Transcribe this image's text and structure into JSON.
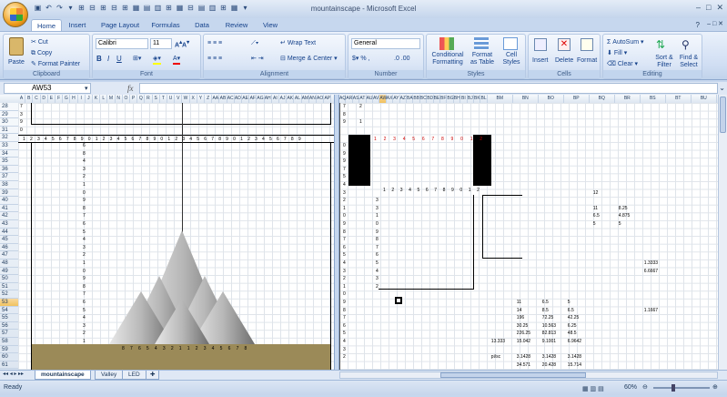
{
  "window": {
    "title": "mountainscape - Microsoft Excel"
  },
  "tabs": [
    "Home",
    "Insert",
    "Page Layout",
    "Formulas",
    "Data",
    "Review",
    "View"
  ],
  "clipboard": {
    "paste": "Paste",
    "cut": "Cut",
    "copy": "Copy",
    "format_painter": "Format Painter",
    "label": "Clipboard"
  },
  "font": {
    "name": "Calibri",
    "size": "11",
    "label": "Font"
  },
  "alignment": {
    "wrap": "Wrap Text",
    "merge": "Merge & Center",
    "label": "Alignment"
  },
  "number": {
    "format": "General",
    "label": "Number"
  },
  "styles": {
    "conditional": "Conditional Formatting",
    "as_table": "Format as Table",
    "cell_styles": "Cell Styles",
    "label": "Styles"
  },
  "cells": {
    "insert": "Insert",
    "delete": "Delete",
    "format": "Format",
    "label": "Cells"
  },
  "editing": {
    "autosum": "AutoSum",
    "fill": "Fill",
    "clear": "Clear",
    "sort": "Sort & Filter",
    "find": "Find & Select",
    "label": "Editing"
  },
  "formula_bar": {
    "name_box": "AW53",
    "fx": "fx",
    "value": ""
  },
  "left_columns": [
    "A",
    "B",
    "C",
    "D",
    "E",
    "F",
    "G",
    "H",
    "I",
    "J",
    "K",
    "L",
    "M",
    "N",
    "O",
    "P",
    "Q",
    "R",
    "S",
    "T",
    "U",
    "V",
    "W",
    "X",
    "Y",
    "Z",
    "AA",
    "AB",
    "AC",
    "AD",
    "AE",
    "AF",
    "AG",
    "AH",
    "AI",
    "AJ",
    "AK",
    "AL",
    "AM",
    "AN",
    "AO",
    "AP"
  ],
  "right_columns": [
    "AQ",
    "AR",
    "AS",
    "AT",
    "AU",
    "AV",
    "AW",
    "AX",
    "AY",
    "AZ",
    "BA",
    "BB",
    "BC",
    "BD",
    "BE",
    "BF",
    "BG",
    "BH",
    "BI",
    "BJ",
    "BK",
    "BL",
    "BM",
    "BN",
    "BO",
    "BP",
    "BQ",
    "BR",
    "BS",
    "BT",
    "BU"
  ],
  "rows": [
    "28",
    "29",
    "30",
    "31",
    "32",
    "33",
    "34",
    "35",
    "36",
    "37",
    "38",
    "39",
    "40",
    "41",
    "42",
    "43",
    "44",
    "45",
    "46",
    "47",
    "48",
    "49",
    "50",
    "51",
    "52",
    "53",
    "54",
    "55",
    "56",
    "57",
    "58",
    "59",
    "60",
    "61"
  ],
  "left_col_i_values": [
    "",
    "",
    "",
    "",
    "",
    "6",
    "8",
    "4",
    "3",
    "2",
    "1",
    "0",
    "9",
    "8",
    "7",
    "6",
    "5",
    "4",
    "3",
    "2",
    "1",
    "0",
    "9",
    "8",
    "7",
    "6",
    "5",
    "4",
    "3",
    "2",
    "1",
    "",
    "",
    ""
  ],
  "left_col_a_values": [
    "7",
    "3",
    "9",
    "0",
    "",
    "",
    "",
    "",
    "",
    "",
    "",
    "",
    "",
    "",
    "",
    "",
    "",
    "",
    "",
    "",
    "",
    "",
    "",
    "",
    "",
    "",
    "",
    "",
    "",
    "",
    "",
    "",
    "",
    ""
  ],
  "ruler_digits": "1 2 3 4 5 6 7 8 9 0 1 2 3 4 5 6 7 8 9 0 1 2 3 4 5 6 7 8 9 0 1 2 3 4 5 6 7 8 9",
  "ground_digits": "8 7 6 5 4 3 2 1 1 2 3 4 5 6 7 8",
  "right_col_aq_values": [
    "7",
    "8",
    "9",
    "",
    "",
    "0",
    "9",
    "9",
    "7",
    "5",
    "4",
    "3",
    "2",
    "1",
    "0",
    "9",
    "8",
    "7",
    "6",
    "5",
    "4",
    "3",
    "2",
    "1",
    "0",
    "9",
    "8",
    "7",
    "6",
    "5",
    "4",
    "3",
    "2",
    ""
  ],
  "right_col_ar_values": [
    "2",
    "",
    "1",
    "",
    "",
    "",
    "",
    "",
    "",
    "",
    "",
    "",
    "",
    "",
    "",
    "",
    "",
    "",
    "",
    "",
    "",
    "",
    "",
    "",
    "",
    "",
    "",
    "",
    "",
    "",
    "",
    "",
    "",
    ""
  ],
  "red_digits": "1 2 3 4 5 6 7 8 9 0 1 2",
  "inner_ruler": "1 2 3 4 5 6 7 8 9 0 1 2",
  "inner_numbers": [
    "1",
    "2",
    "3",
    "4",
    "5",
    "6",
    "7",
    "8",
    "9",
    "0",
    "1",
    "2"
  ],
  "inner_side_numbers": [
    "3",
    "3",
    "1",
    "0",
    "9",
    "8",
    "7",
    "6",
    "5",
    "4",
    "3",
    "2"
  ],
  "data_values": [
    {
      "col": "BQ",
      "row": 39,
      "text": "12"
    },
    {
      "col": "BQ",
      "row": 41,
      "text": "11"
    },
    {
      "col": "BR",
      "row": 41,
      "text": "8.25"
    },
    {
      "col": "BQ",
      "row": 42,
      "text": "6.5"
    },
    {
      "col": "BR",
      "row": 42,
      "text": "4.875"
    },
    {
      "col": "BQ",
      "row": 43,
      "text": "5"
    },
    {
      "col": "BR",
      "row": 43,
      "text": "5"
    },
    {
      "col": "BS",
      "row": 48,
      "text": "1.3333"
    },
    {
      "col": "BS",
      "row": 49,
      "text": "6.6667"
    },
    {
      "col": "BN",
      "row": 53,
      "text": "11"
    },
    {
      "col": "BO",
      "row": 53,
      "text": "6.5"
    },
    {
      "col": "BP",
      "row": 53,
      "text": "5"
    },
    {
      "col": "BN",
      "row": 54,
      "text": "14"
    },
    {
      "col": "BO",
      "row": 54,
      "text": "8.5"
    },
    {
      "col": "BP",
      "row": 54,
      "text": "6.5"
    },
    {
      "col": "BS",
      "row": 54,
      "text": "1.1667"
    },
    {
      "col": "BN",
      "row": 55,
      "text": "196"
    },
    {
      "col": "BO",
      "row": 55,
      "text": "72.25"
    },
    {
      "col": "BP",
      "row": 55,
      "text": "42.25"
    },
    {
      "col": "BN",
      "row": 56,
      "text": "30.25"
    },
    {
      "col": "BO",
      "row": 56,
      "text": "10.563"
    },
    {
      "col": "BP",
      "row": 56,
      "text": "6.25"
    },
    {
      "col": "BN",
      "row": 57,
      "text": "226.25"
    },
    {
      "col": "BO",
      "row": 57,
      "text": "82.813"
    },
    {
      "col": "BP",
      "row": 57,
      "text": "48.5"
    },
    {
      "col": "BM",
      "row": 58,
      "text": "13.333"
    },
    {
      "col": "BN",
      "row": 58,
      "text": "15.042"
    },
    {
      "col": "BO",
      "row": 58,
      "text": "9.1001"
    },
    {
      "col": "BP",
      "row": 58,
      "text": "6.9642"
    },
    {
      "col": "BM",
      "row": 60,
      "text": "pi/sc"
    },
    {
      "col": "BN",
      "row": 60,
      "text": "3.1428"
    },
    {
      "col": "BO",
      "row": 60,
      "text": "3.1428"
    },
    {
      "col": "BP",
      "row": 60,
      "text": "3.1428"
    },
    {
      "col": "BN",
      "row": 61,
      "text": "34.571"
    },
    {
      "col": "BO",
      "row": 61,
      "text": "20.428"
    },
    {
      "col": "BP",
      "row": 61,
      "text": "15.714"
    }
  ],
  "sheets": [
    "mountainscape",
    "Valley",
    "LED"
  ],
  "status": {
    "ready": "Ready",
    "zoom": "60%"
  },
  "colors": {
    "ribbon": "#d0def3",
    "ground": "#9b8a58",
    "selected_header": "#f1c15f",
    "mountain": "#9a9a9a"
  }
}
